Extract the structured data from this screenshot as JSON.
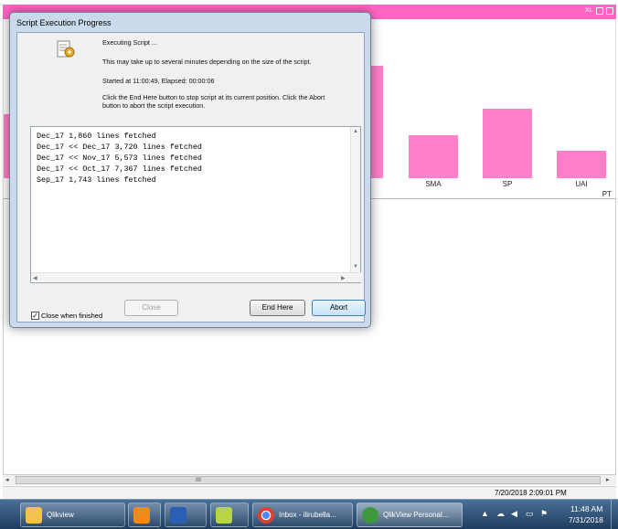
{
  "background": {
    "window_controls_label": "XL",
    "chart_categories": [
      "SMA",
      "SP",
      "UAI"
    ],
    "chart_tail_label": "PT",
    "status_time": "7/20/2018 2:09:01 PM",
    "scroll_grip": "ⅡⅡ"
  },
  "dialog": {
    "title": "Script Execution Progress",
    "status_heading": "Executing Script ...",
    "wait_note": "This may take up to several minutes depending on the size of the script.",
    "timing": "Started at 11:00:49, Elapsed: 00:00:06",
    "instruction_line1": "Click the End Here button to stop script at its current position. Click the Abort",
    "instruction_line2": "button to abort the script execution.",
    "log_lines": [
      "Dec_17 1,860 lines fetched",
      "Dec_17 << Dec_17 3,720 lines fetched",
      "Dec_17 << Nov_17 5,573 lines fetched",
      "Dec_17 << Oct_17 7,367 lines fetched",
      "Sep_17 1,743 lines fetched"
    ],
    "close_when_finished_label": "Close when finished",
    "close_when_finished_checked": true,
    "close_button": "Close",
    "end_here_button": "End Here",
    "abort_button": "Abort"
  },
  "taskbar": {
    "items": [
      {
        "label": "Qlikview",
        "icon": "folder-icon"
      },
      {
        "label": "",
        "icon": "media-player-icon"
      },
      {
        "label": "",
        "icon": "word-icon"
      },
      {
        "label": "",
        "icon": "app-icon"
      },
      {
        "label": "Inbox - ilirubella...",
        "icon": "chrome-icon"
      },
      {
        "label": "QlikView Personal...",
        "icon": "qlikview-icon"
      }
    ],
    "clock_time": "11:48 AM",
    "clock_date": "7/31/2018"
  },
  "colors": {
    "bar_pink": "#ff7fc8",
    "band_pink": "#ff66c4",
    "taskbar_blue": "#2a4b70"
  }
}
